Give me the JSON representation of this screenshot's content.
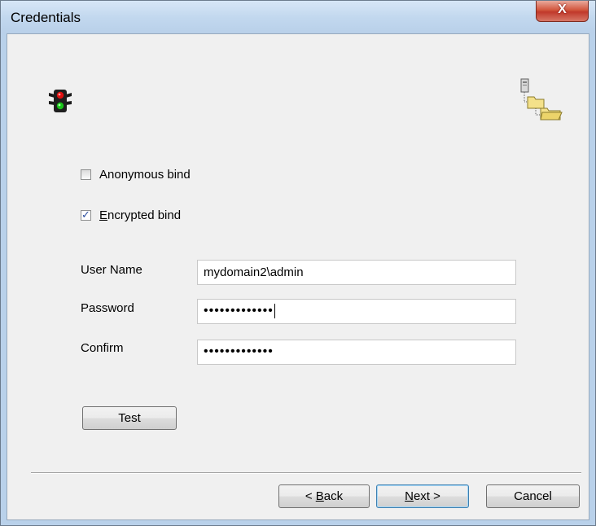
{
  "window": {
    "title": "Credentials",
    "close_glyph": "X"
  },
  "icons": {
    "left": "traffic-light-icon",
    "right": "directory-tree-icon"
  },
  "options": {
    "anonymous_bind": {
      "label": "Anonymous bind",
      "checked": false
    },
    "encrypted_bind": {
      "label": "Encrypted bind",
      "mnemonic": "E",
      "label_rest": "ncrypted bind",
      "checked": true
    }
  },
  "fields": {
    "user_name": {
      "label": "User Name",
      "value": "mydomain2\\admin"
    },
    "password": {
      "label": "Password",
      "value": "•••••••••••••"
    },
    "confirm": {
      "label": "Confirm",
      "value": "•••••••••••••"
    }
  },
  "buttons": {
    "test": "Test",
    "back_prefix": "< ",
    "back_mnemonic": "B",
    "back_rest": "ack",
    "next_mnemonic": "N",
    "next_rest": "ext >",
    "cancel": "Cancel"
  }
}
